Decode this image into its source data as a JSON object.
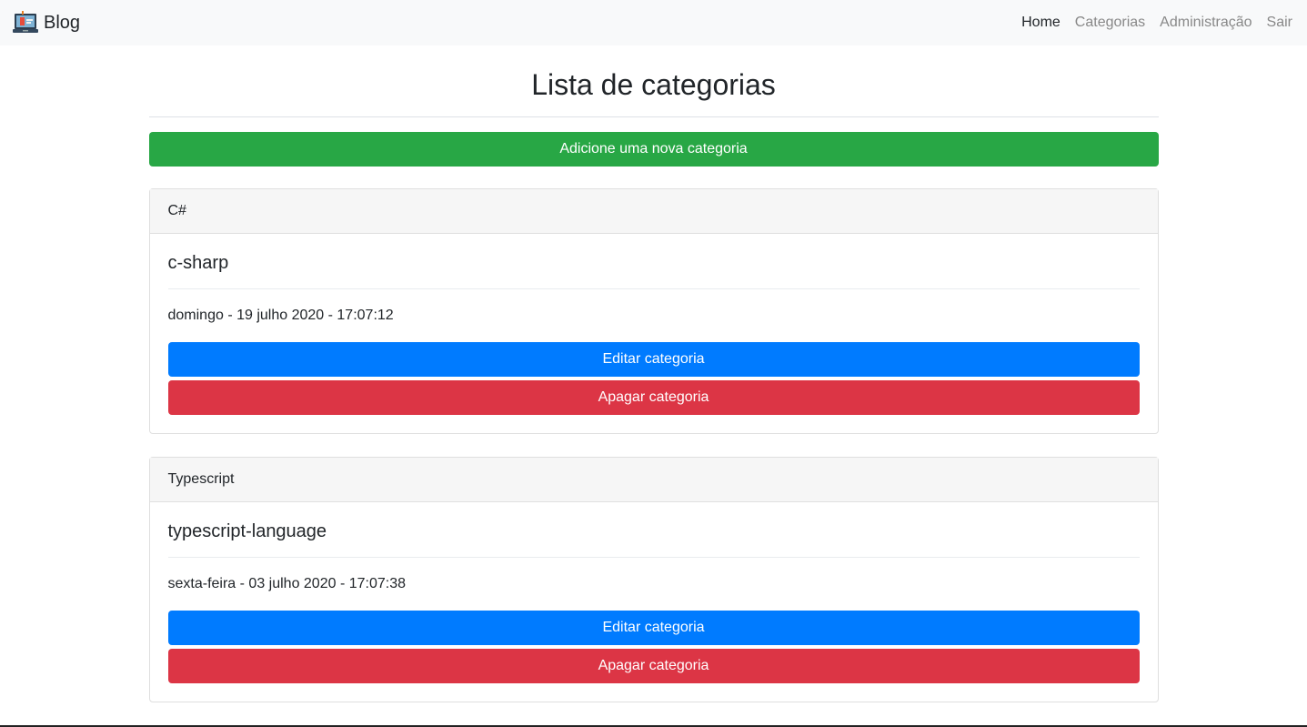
{
  "navbar": {
    "brand": "Blog",
    "brand_icon": "laptop-icon",
    "links": [
      {
        "label": "Home",
        "active": true
      },
      {
        "label": "Categorias",
        "active": false
      },
      {
        "label": "Administração",
        "active": false
      },
      {
        "label": "Sair",
        "active": false
      }
    ]
  },
  "page": {
    "title": "Lista de categorias",
    "add_button": "Adicione uma nova categoria"
  },
  "categories": [
    {
      "name": "C#",
      "slug": "c-sharp",
      "date": "domingo - 19 julho 2020 - 17:07:12",
      "edit_label": "Editar categoria",
      "delete_label": "Apagar categoria"
    },
    {
      "name": "Typescript",
      "slug": "typescript-language",
      "date": "sexta-feira - 03 julho 2020 - 17:07:38",
      "edit_label": "Editar categoria",
      "delete_label": "Apagar categoria"
    }
  ],
  "colors": {
    "success": "#28a745",
    "primary": "#007bff",
    "danger": "#dc3545",
    "navbar_bg": "#f8f9fa"
  }
}
